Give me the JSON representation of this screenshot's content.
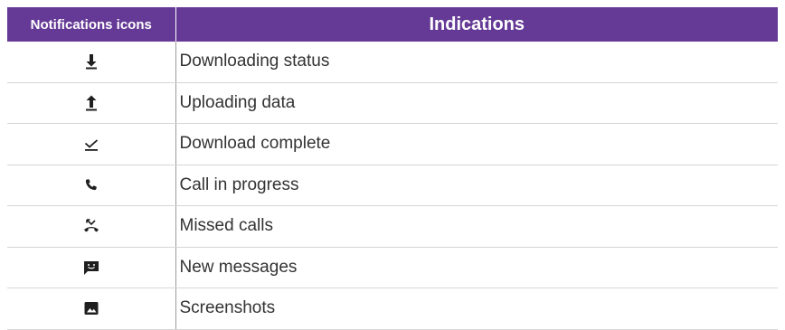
{
  "table": {
    "headers": {
      "icons": "Notifications icons",
      "indications": "Indications"
    },
    "rows": [
      {
        "icon": "download-arrow-icon",
        "label": "Downloading status"
      },
      {
        "icon": "upload-arrow-icon",
        "label": "Uploading data"
      },
      {
        "icon": "download-complete-icon",
        "label": "Download complete"
      },
      {
        "icon": "phone-icon",
        "label": "Call in progress"
      },
      {
        "icon": "missed-call-icon",
        "label": "Missed calls"
      },
      {
        "icon": "message-icon",
        "label": "New messages"
      },
      {
        "icon": "screenshot-icon",
        "label": "Screenshots"
      }
    ]
  },
  "colors": {
    "header_bg": "#653a96",
    "icon_color": "#1f1f1f"
  }
}
